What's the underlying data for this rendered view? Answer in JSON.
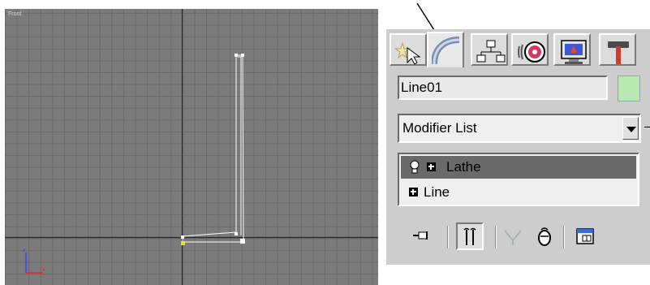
{
  "viewport": {
    "label": "Front",
    "background": "#7b7b7b",
    "axis_icon": "xyz-axis-tripod-icon"
  },
  "command_panel": {
    "tabs": [
      {
        "name": "create",
        "icon": "create-star-cursor-icon",
        "active": false
      },
      {
        "name": "modify",
        "icon": "modify-bend-icon",
        "active": true
      },
      {
        "name": "hierarchy",
        "icon": "hierarchy-icon",
        "active": false
      },
      {
        "name": "motion",
        "icon": "motion-wheel-icon",
        "active": false
      },
      {
        "name": "display",
        "icon": "display-monitor-icon",
        "active": false
      },
      {
        "name": "utilities",
        "icon": "utilities-hammer-icon",
        "active": false
      }
    ],
    "object_name": "Line01",
    "object_color": "#b9e8b2",
    "modifier_list_label": "Modifier List",
    "stack": [
      {
        "label": "Lathe",
        "selected": true,
        "icon": "lightbulb-icon"
      },
      {
        "label": "Line",
        "selected": false
      }
    ],
    "toolbar_icons": [
      "pin-stack-icon",
      "show-end-result-icon",
      "make-unique-icon",
      "remove-modifier-icon",
      "configure-modifier-sets-icon"
    ]
  }
}
